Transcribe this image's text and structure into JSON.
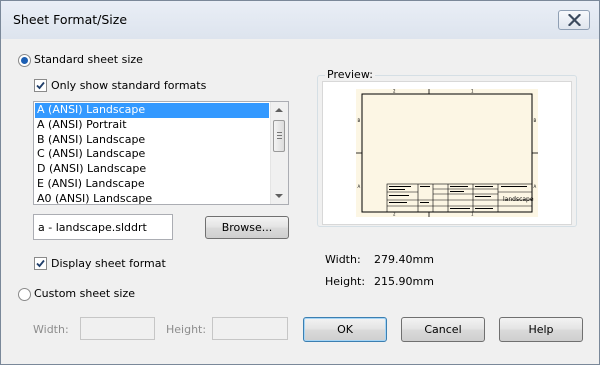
{
  "window": {
    "title": "Sheet Format/Size",
    "close_icon": "close-icon"
  },
  "standard": {
    "radio_label": "Standard sheet size",
    "only_standard_label": "Only show standard formats",
    "formats": [
      "A (ANSI) Landscape",
      "A (ANSI) Portrait",
      "B (ANSI) Landscape",
      "C (ANSI) Landscape",
      "D (ANSI) Landscape",
      "E (ANSI) Landscape",
      "A0 (ANSI) Landscape"
    ],
    "selected_format": "A (ANSI) Landscape",
    "file_value": "a - landscape.slddrt",
    "browse_label": "Browse...",
    "display_format_label": "Display sheet format"
  },
  "custom": {
    "radio_label": "Custom sheet size",
    "width_label": "Width:",
    "height_label": "Height:",
    "width_value": "",
    "height_value": ""
  },
  "preview": {
    "legend": "Preview:",
    "width_label": "Width:",
    "width_value": "279.40mm",
    "height_label": "Height:",
    "height_value": "215.90mm",
    "title_block_text": "landscape",
    "zone_labels": [
      "2",
      "1",
      "B",
      "A"
    ],
    "colors": {
      "sheet_bg": "#fcf6e4",
      "line": "#000000"
    }
  },
  "buttons": {
    "ok": "OK",
    "cancel": "Cancel",
    "help": "Help"
  },
  "colors": {
    "dialog_bg": "#f0f0f0",
    "selection_bg": "#3399ff",
    "radio_dot": "#1d5fb3"
  }
}
